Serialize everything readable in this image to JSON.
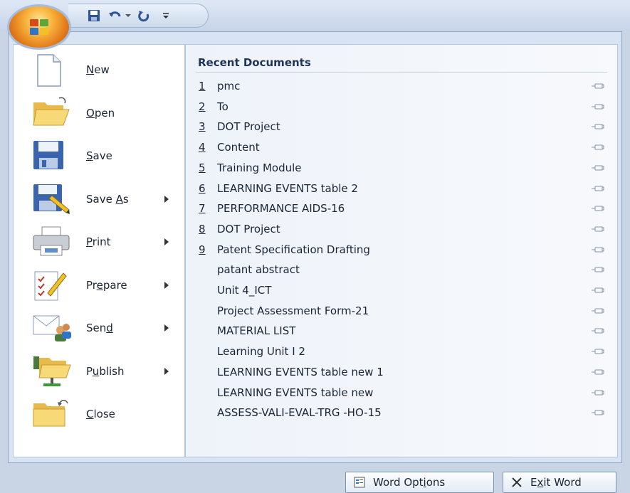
{
  "menu": [
    {
      "id": "new",
      "pre": "",
      "u": "N",
      "post": "ew",
      "arrow": false,
      "icon": "new-document-icon"
    },
    {
      "id": "open",
      "pre": "",
      "u": "O",
      "post": "pen",
      "arrow": false,
      "icon": "open-folder-icon"
    },
    {
      "id": "save",
      "pre": "",
      "u": "S",
      "post": "ave",
      "arrow": false,
      "icon": "save-floppy-icon"
    },
    {
      "id": "save-as",
      "pre": "Save ",
      "u": "A",
      "post": "s",
      "arrow": true,
      "icon": "save-as-icon"
    },
    {
      "id": "print",
      "pre": "",
      "u": "P",
      "post": "rint",
      "arrow": true,
      "icon": "printer-icon"
    },
    {
      "id": "prepare",
      "pre": "Pr",
      "u": "e",
      "post": "pare",
      "arrow": true,
      "icon": "prepare-document-icon"
    },
    {
      "id": "send",
      "pre": "Sen",
      "u": "d",
      "post": "",
      "arrow": true,
      "icon": "send-icon"
    },
    {
      "id": "publish",
      "pre": "P",
      "u": "u",
      "post": "blish",
      "arrow": true,
      "icon": "publish-icon"
    },
    {
      "id": "close",
      "pre": "",
      "u": "C",
      "post": "lose",
      "arrow": false,
      "icon": "close-folder-icon"
    }
  ],
  "recent": {
    "title": "Recent Documents",
    "items": [
      {
        "num": "1",
        "name": "pmc"
      },
      {
        "num": "2",
        "name": "To"
      },
      {
        "num": "3",
        "name": "DOT Project"
      },
      {
        "num": "4",
        "name": "Content"
      },
      {
        "num": "5",
        "name": "Training Module"
      },
      {
        "num": "6",
        "name": "LEARNING EVENTS table 2"
      },
      {
        "num": "7",
        "name": "PERFORMANCE AIDS-16"
      },
      {
        "num": "8",
        "name": "DOT Project"
      },
      {
        "num": "9",
        "name": "Patent Specification Drafting"
      },
      {
        "num": "",
        "name": "patant abstract"
      },
      {
        "num": "",
        "name": "Unit 4_ICT"
      },
      {
        "num": "",
        "name": "Project Assessment Form-21"
      },
      {
        "num": "",
        "name": "MATERIAL LIST"
      },
      {
        "num": "",
        "name": "Learning Unit I 2"
      },
      {
        "num": "",
        "name": "LEARNING EVENTS table new 1"
      },
      {
        "num": "",
        "name": "LEARNING EVENTS table new"
      },
      {
        "num": "",
        "name": "ASSESS-VALI-EVAL-TRG -HO-15"
      }
    ]
  },
  "footer": {
    "options": {
      "pre": "Word Opt",
      "u": "i",
      "post": "ons"
    },
    "exit": {
      "pre": "E",
      "u": "x",
      "post": "it Word"
    }
  },
  "colors": {
    "accent": "#f9b13a",
    "frame": "#d8e4f3",
    "text": "#1b2535"
  }
}
